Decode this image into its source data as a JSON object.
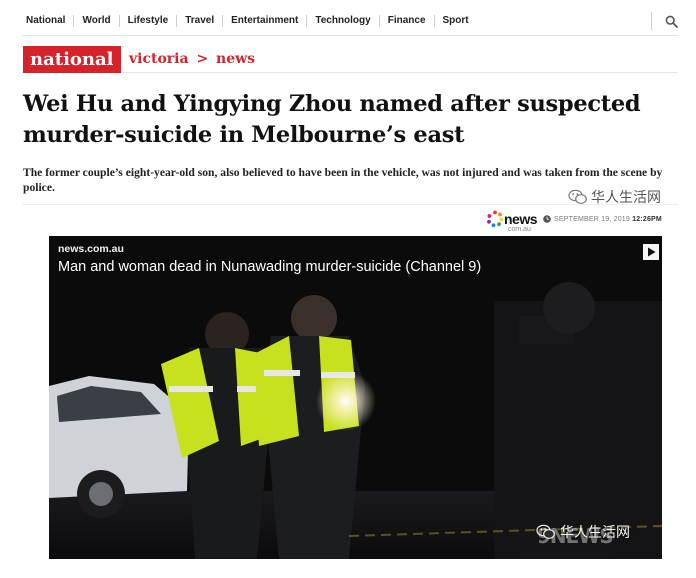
{
  "nav": {
    "items": [
      "National",
      "World",
      "Lifestyle",
      "Travel",
      "Entertainment",
      "Technology",
      "Finance",
      "Sport"
    ],
    "search_icon": "search-icon"
  },
  "section": {
    "badge": "national",
    "crumb_1": "victoria",
    "separator": ">",
    "crumb_2": "news"
  },
  "article": {
    "headline": "Wei Hu and Yingying Zhou named after suspected murder-suicide in Melbourne’s east",
    "standfirst": "The former couple’s eight-year-old son, also believed to have been in the vehicle, was not injured and was taken from the scene by police."
  },
  "byline": {
    "source_logo": "news",
    "source_logo_sub": "com.au",
    "date": "SEPTEMBER 19, 2019",
    "time": "12:26PM",
    "clock_icon": "clock-icon"
  },
  "video": {
    "source": "news.com.au",
    "title": "Man and woman dead in Nunawading murder-suicide (Channel 9)",
    "brand": "9NEWS",
    "play_icon": "play-icon"
  },
  "watermark": {
    "text": "华人生活网",
    "icon": "wechat-icon"
  },
  "colors": {
    "accent": "#d6222a",
    "text": "#111111",
    "video_bg": "#0a0a0b"
  }
}
